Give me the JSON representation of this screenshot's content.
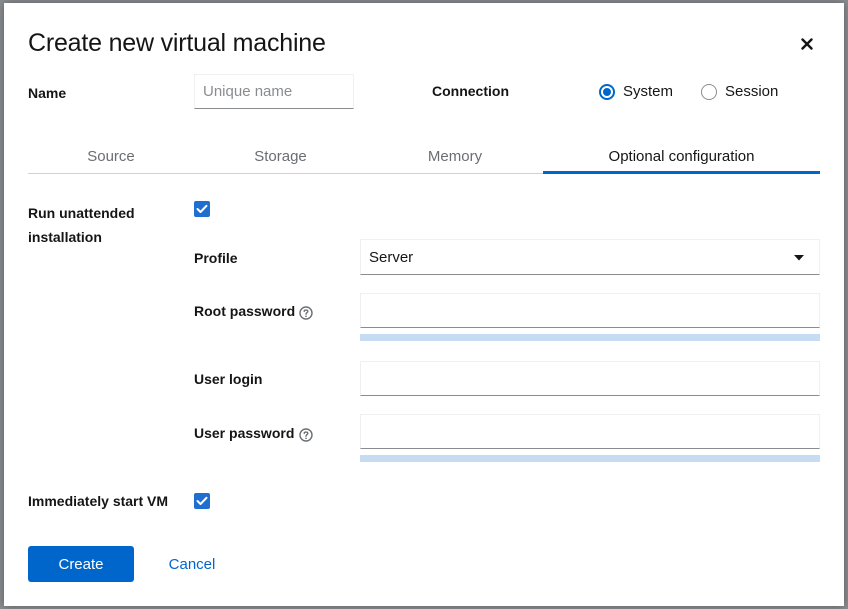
{
  "dialog": {
    "title": "Create new virtual machine"
  },
  "name_field": {
    "label": "Name",
    "placeholder": "Unique name",
    "value": ""
  },
  "connection": {
    "label": "Connection",
    "options": [
      {
        "label": "System",
        "checked": true
      },
      {
        "label": "Session",
        "checked": false
      }
    ]
  },
  "tabs": [
    {
      "label": "Source",
      "active": false
    },
    {
      "label": "Storage",
      "active": false
    },
    {
      "label": "Memory",
      "active": false
    },
    {
      "label": "Optional configuration",
      "active": true
    }
  ],
  "unattended": {
    "label": "Run unattended installation",
    "checked": true
  },
  "profile": {
    "label": "Profile",
    "selected": "Server"
  },
  "root_password": {
    "label": "Root password",
    "value": ""
  },
  "user_login": {
    "label": "User login",
    "value": ""
  },
  "user_password": {
    "label": "User password",
    "value": ""
  },
  "start_vm": {
    "label": "Immediately start VM",
    "checked": true
  },
  "actions": {
    "create_label": "Create",
    "cancel_label": "Cancel"
  },
  "icons": {
    "close": "close-icon",
    "help": "question-circle-icon",
    "caret": "caret-down-icon",
    "check": "check-icon"
  },
  "colors": {
    "accent": "#0066cc",
    "checkbox": "#1f6fd0",
    "strength_bar": "#c6dcf3"
  }
}
